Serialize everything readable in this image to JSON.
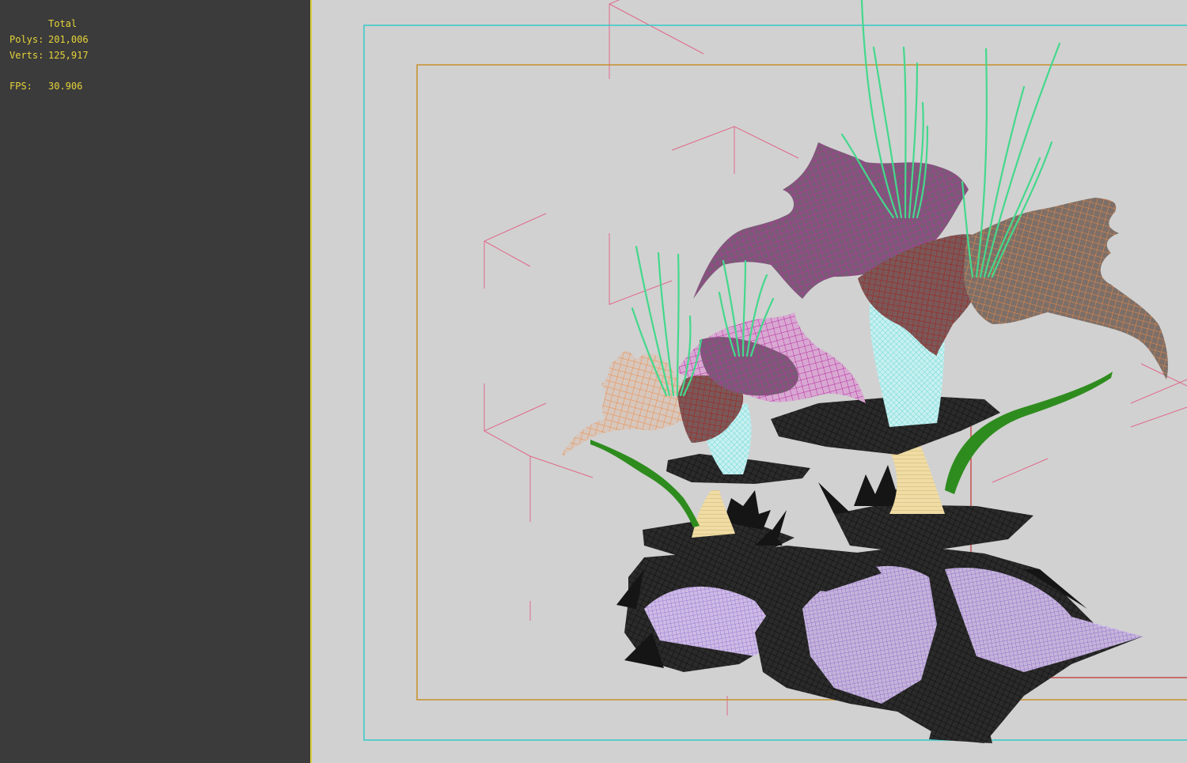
{
  "stats": {
    "title": "Total",
    "polys_label": "Polys:",
    "polys_value": "201,006",
    "verts_label": "Verts:",
    "verts_value": "125,917",
    "fps_label": "FPS:",
    "fps_value": "30.906"
  },
  "colors": {
    "left_viewport_bg": "#3b3b3b",
    "right_viewport_bg": "#d1d1d1",
    "stats_text": "#e6d33a",
    "safe_frame_outer": "#35c9c9",
    "safe_frame_inner": "#c8902a",
    "grid_lines": "#e06a8a",
    "mesh_dark": "#1a1a1a",
    "mesh_magenta": "#b4289e",
    "mesh_orange": "#e0823c",
    "mesh_red": "#9a1d1d",
    "mesh_cyan": "#9ee4e4",
    "mesh_lilac": "#b896e6",
    "grass": "#44d88c",
    "vine": "#2e8c1e",
    "stem": "#e8d096"
  },
  "icons": [
    "wireframe-mesh",
    "safe-frame",
    "grid-box"
  ]
}
